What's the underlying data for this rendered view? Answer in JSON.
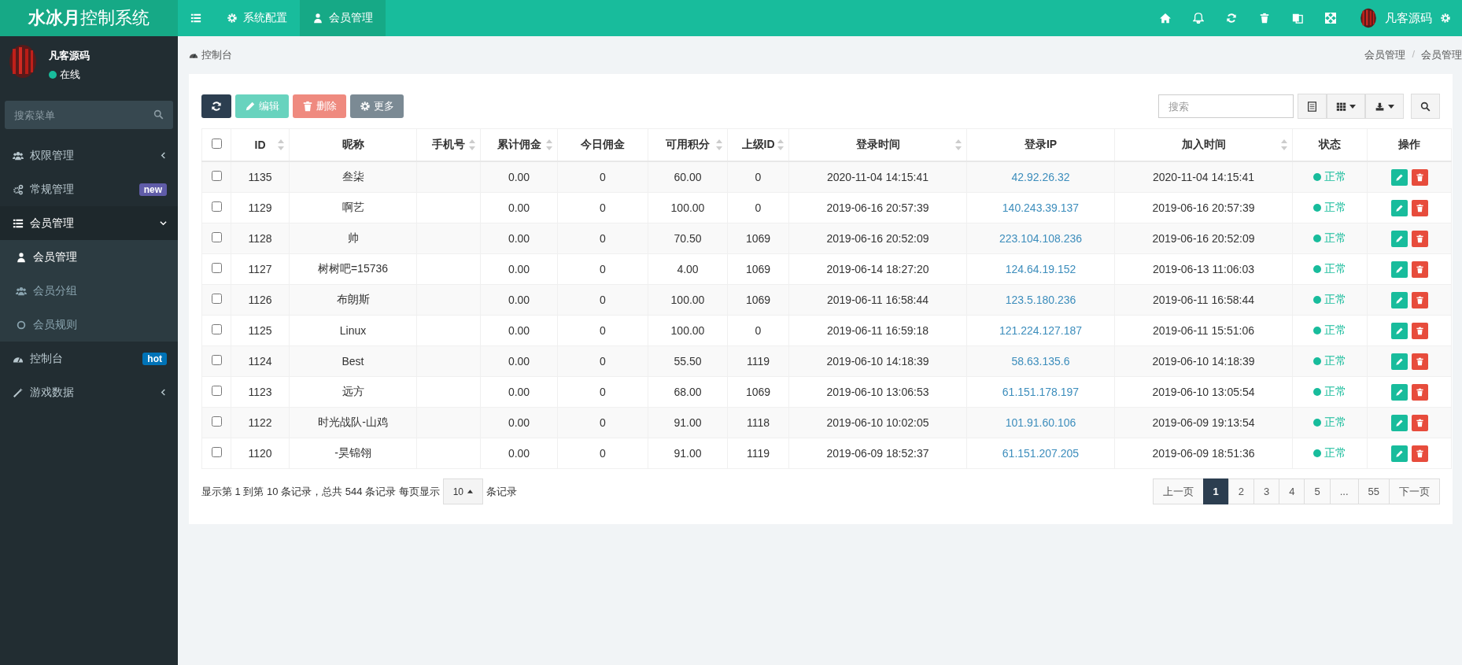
{
  "brand": {
    "bold": "水冰月",
    "rest": "控制系统"
  },
  "top_nav": [
    {
      "label": "系统配置",
      "kind": "gear",
      "selected": false
    },
    {
      "label": "会员管理",
      "kind": "user",
      "selected": true
    }
  ],
  "top_user": "凡客源码",
  "profile": {
    "name": "凡客源码",
    "status": "在线"
  },
  "sidebar": {
    "search_placeholder": "搜索菜单",
    "items": [
      {
        "label": "权限管理",
        "kind": "users",
        "selected": false,
        "expanded": false
      },
      {
        "label": "常规管理",
        "kind": "cogs",
        "selected": false,
        "badge": "new",
        "color": "#605ca8"
      },
      {
        "label": "会员管理",
        "kind": "list",
        "selected": true,
        "expanded": true,
        "children": [
          {
            "label": "会员管理",
            "kind": "user",
            "selected": true
          },
          {
            "label": "会员分组",
            "kind": "users",
            "selected": false
          },
          {
            "label": "会员规则",
            "kind": "circle",
            "selected": false
          }
        ]
      },
      {
        "label": "控制台",
        "kind": "dashboard",
        "selected": false,
        "badge": "hot",
        "color": "#0073b7"
      },
      {
        "label": "游戏数据",
        "kind": "magic",
        "selected": false,
        "expanded": false
      }
    ]
  },
  "breadcrumb": {
    "title": "控制台",
    "trail": [
      "会员管理",
      "会员管理"
    ],
    "separator": "/"
  },
  "toolbar": [
    {
      "kind": "refresh",
      "disabled": false
    },
    {
      "kind": "edit",
      "label": "编辑",
      "disabled": true
    },
    {
      "kind": "delete",
      "label": "删除",
      "disabled": true
    },
    {
      "kind": "more",
      "label": "更多",
      "disabled": false
    }
  ],
  "search": {
    "placeholder": "搜索"
  },
  "table": {
    "all_checked": false,
    "columns": [
      {
        "label": "ID",
        "sortable": true
      },
      {
        "label": "昵称",
        "sortable": false
      },
      {
        "label": "手机号",
        "sortable": true
      },
      {
        "label": "累计佣金",
        "sortable": true
      },
      {
        "label": "今日佣金",
        "sortable": false
      },
      {
        "label": "可用积分",
        "sortable": true
      },
      {
        "label": "上级ID",
        "sortable": true
      },
      {
        "label": "登录时间",
        "sortable": true
      },
      {
        "label": "登录IP",
        "sortable": false
      },
      {
        "label": "加入时间",
        "sortable": true
      },
      {
        "label": "状态",
        "sortable": false
      },
      {
        "label": "操作",
        "sortable": false
      }
    ],
    "rows": [
      {
        "checked": false,
        "id": "1135",
        "nickname": "叁柒",
        "commission_total": "0.00",
        "commission_today": "0",
        "points": "60.00",
        "parent_id": "0",
        "login_time": "2020-11-04 14:15:41",
        "login_ip": "42.92.26.32",
        "join_time": "2020-11-04 14:15:41",
        "status": "正常"
      },
      {
        "checked": false,
        "id": "1129",
        "nickname": "啊艺",
        "commission_total": "0.00",
        "commission_today": "0",
        "points": "100.00",
        "parent_id": "0",
        "login_time": "2019-06-16 20:57:39",
        "login_ip": "140.243.39.137",
        "join_time": "2019-06-16 20:57:39",
        "status": "正常"
      },
      {
        "checked": false,
        "id": "1128",
        "nickname": "帅",
        "commission_total": "0.00",
        "commission_today": "0",
        "points": "70.50",
        "parent_id": "1069",
        "login_time": "2019-06-16 20:52:09",
        "login_ip": "223.104.108.236",
        "join_time": "2019-06-16 20:52:09",
        "status": "正常"
      },
      {
        "checked": false,
        "id": "1127",
        "nickname": "树树吧=15736",
        "commission_total": "0.00",
        "commission_today": "0",
        "points": "4.00",
        "parent_id": "1069",
        "login_time": "2019-06-14 18:27:20",
        "login_ip": "124.64.19.152",
        "join_time": "2019-06-13 11:06:03",
        "status": "正常"
      },
      {
        "checked": false,
        "id": "1126",
        "nickname": "布朗斯",
        "commission_total": "0.00",
        "commission_today": "0",
        "points": "100.00",
        "parent_id": "1069",
        "login_time": "2019-06-11 16:58:44",
        "login_ip": "123.5.180.236",
        "join_time": "2019-06-11 16:58:44",
        "status": "正常"
      },
      {
        "checked": false,
        "id": "1125",
        "nickname": "Linux",
        "commission_total": "0.00",
        "commission_today": "0",
        "points": "100.00",
        "parent_id": "0",
        "login_time": "2019-06-11 16:59:18",
        "login_ip": "121.224.127.187",
        "join_time": "2019-06-11 15:51:06",
        "status": "正常"
      },
      {
        "checked": false,
        "id": "1124",
        "nickname": "Best",
        "commission_total": "0.00",
        "commission_today": "0",
        "points": "55.50",
        "parent_id": "1119",
        "login_time": "2019-06-10 14:18:39",
        "login_ip": "58.63.135.6",
        "join_time": "2019-06-10 14:18:39",
        "status": "正常"
      },
      {
        "checked": false,
        "id": "1123",
        "nickname": "远方",
        "commission_total": "0.00",
        "commission_today": "0",
        "points": "68.00",
        "parent_id": "1069",
        "login_time": "2019-06-10 13:06:53",
        "login_ip": "61.151.178.197",
        "join_time": "2019-06-10 13:05:54",
        "status": "正常"
      },
      {
        "checked": false,
        "id": "1122",
        "nickname": "时光战队-山鸡",
        "commission_total": "0.00",
        "commission_today": "0",
        "points": "91.00",
        "parent_id": "1118",
        "login_time": "2019-06-10 10:02:05",
        "login_ip": "101.91.60.106",
        "join_time": "2019-06-09 19:13:54",
        "status": "正常"
      },
      {
        "checked": false,
        "id": "1120",
        "nickname": "-昊锦翎",
        "commission_total": "0.00",
        "commission_today": "0",
        "points": "91.00",
        "parent_id": "1119",
        "login_time": "2019-06-09 18:52:37",
        "login_ip": "61.151.207.205",
        "join_time": "2019-06-09 18:51:36",
        "status": "正常"
      }
    ]
  },
  "pagination": {
    "summary": "显示第 1 到第 10 条记录，总共 544 条记录 每页显示",
    "page_size": "10",
    "suffix": "条记录",
    "pages": [
      {
        "label": "上一页",
        "selected": false
      },
      {
        "label": "1",
        "selected": true
      },
      {
        "label": "2",
        "selected": false
      },
      {
        "label": "3",
        "selected": false
      },
      {
        "label": "4",
        "selected": false
      },
      {
        "label": "5",
        "selected": false
      },
      {
        "label": "...",
        "selected": false
      },
      {
        "label": "55",
        "selected": false
      },
      {
        "label": "下一页",
        "selected": false
      }
    ]
  }
}
